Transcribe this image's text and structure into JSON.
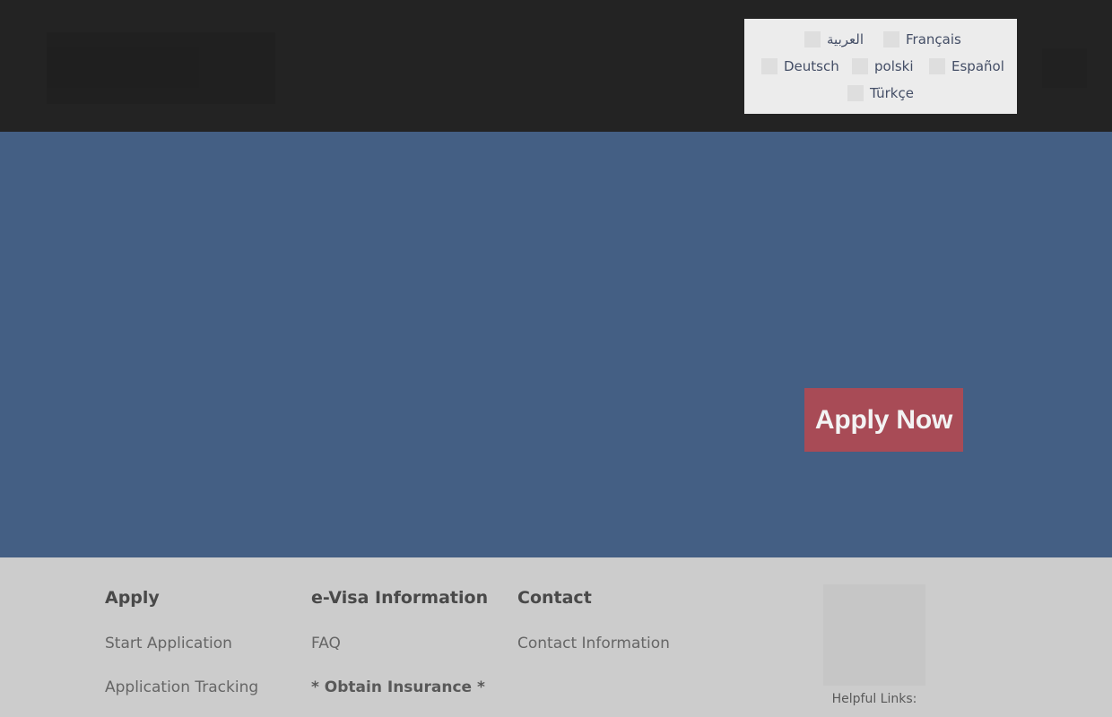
{
  "languages": [
    {
      "label": "العربية"
    },
    {
      "label": "Français"
    },
    {
      "label": "Deutsch"
    },
    {
      "label": "polski"
    },
    {
      "label": "Español"
    },
    {
      "label": "Türkçe"
    }
  ],
  "hero": {
    "apply_label": "Apply Now"
  },
  "footer": {
    "apply": {
      "title": "Apply",
      "links": [
        "Start Application",
        "Application Tracking"
      ]
    },
    "evisa": {
      "title": "e-Visa Information",
      "links": [
        "FAQ",
        "* Obtain Insurance *"
      ]
    },
    "contact": {
      "title": "Contact",
      "links": [
        "Contact Information"
      ]
    },
    "helpful_label": "Helpful Links:"
  },
  "colors": {
    "header_bg": "#232323",
    "hero_bg": "#445f84",
    "apply_button": "#a84b56",
    "footer_bg": "#cccccc"
  }
}
